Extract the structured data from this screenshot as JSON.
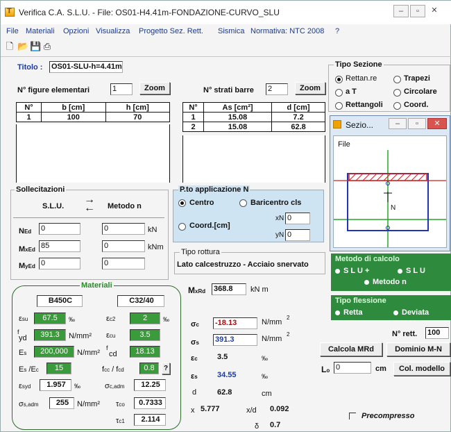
{
  "window": {
    "title": "Verifica C.A. S.L.U. - File: OS01-H4.41m-FONDAZIONE-CURVO_SLU"
  },
  "menu": [
    "File",
    "Materiali",
    "Opzioni",
    "Visualizza",
    "Progetto Sez. Rett.",
    "Sismica",
    "Normativa: NTC 2008",
    "?"
  ],
  "toolbar_icons": [
    "new-icon",
    "open-icon",
    "save-icon",
    "print-icon"
  ],
  "titolo": {
    "label": "Titolo :",
    "value": "OS01-SLU-h=4.41m"
  },
  "figure": {
    "label": "N° figure elementari",
    "value": "1",
    "zoom": "Zoom",
    "headers": [
      "N°",
      "b [cm]",
      "h [cm]"
    ],
    "rows": [
      [
        "1",
        "100",
        "70"
      ]
    ]
  },
  "strati": {
    "label": "N° strati barre",
    "value": "2",
    "zoom": "Zoom",
    "headers": [
      "N°",
      "As [cm²]",
      "d [cm]"
    ],
    "rows": [
      [
        "1",
        "15.08",
        "7.2"
      ],
      [
        "2",
        "15.08",
        "62.8"
      ]
    ]
  },
  "tipo_sezione": {
    "title": "Tipo Sezione",
    "options": [
      "Rettan.re",
      "Trapezi",
      "a T",
      "Circolare",
      "Rettangoli",
      "Coord."
    ],
    "selected": "Rettan.re"
  },
  "sezio_window": {
    "title": "Sezio...",
    "menu": "File",
    "n_label": "N"
  },
  "sollecitazioni": {
    "title": "Sollecitazioni",
    "slu": "S.L.U.",
    "metodo": "Metodo n",
    "NEd": "0",
    "MxEd": "85",
    "MyEd": "0",
    "col2": [
      "0",
      "0",
      "0"
    ],
    "unit_n": "kN",
    "unit_m": "kNm"
  },
  "pto_applicazione": {
    "title": "P.to applicazione N",
    "centro": "Centro",
    "baricentro": "Baricentro cls",
    "coord": "Coord.[cm]",
    "xN": "0",
    "yN": "0",
    "xN_label": "xN",
    "yN_label": "yN"
  },
  "tipo_rottura": {
    "title": "Tipo rottura",
    "value": "Lato calcestruzzo - Acciaio snervato"
  },
  "metodo_calcolo": {
    "title": "Metodo di calcolo",
    "opt1": "S L U +",
    "opt2": "S L U",
    "opt3": "Metodo n"
  },
  "tipo_flessione": {
    "title": "Tipo flessione",
    "opt1": "Retta",
    "opt2": "Deviata"
  },
  "materiali": {
    "title": "Materiali",
    "steel": "B450C",
    "concrete": "C32/40",
    "esu": "67.5",
    "ec2": "2",
    "ecu": "3.5",
    "fyd": "391.3",
    "Es": "200,000",
    "fcd": "18.13",
    "EsEc": "15",
    "fccfcd": "0.8",
    "esyd": "1.957",
    "sc_adm": "12.25",
    "ss_adm": "255",
    "tco": "0.7333",
    "tc1": "2.114",
    "unit_permil": "‰",
    "unit_nmm2": "N/mm²",
    "q": "?"
  },
  "results": {
    "MxRd_label": "M",
    "MxRd": "368.8",
    "MxRd_unit": "kN m",
    "sc": "-18.13",
    "ss": "391.3",
    "ec": "3.5",
    "es": "34.55",
    "d": "62.8",
    "x": "5.777",
    "xd": "0.092",
    "delta": "0.7",
    "unit_nmm2": "N/mm",
    "unit_permil": "‰",
    "unit_cm": "cm",
    "x_label": "x",
    "xd_label": "x/d",
    "d_label": "d",
    "delta_label": "δ"
  },
  "n_rett": {
    "label": "N° rett.",
    "value": "100"
  },
  "buttons": {
    "calcola": "Calcola MRd",
    "dominio": "Dominio M-N",
    "col_modello": "Col. modello"
  },
  "L0": {
    "label": "L",
    "value": "0",
    "unit": "cm"
  },
  "precompresso": "Precompresso",
  "colors": {
    "green": "#3a9b3a",
    "panel_green": "#2e8b3e",
    "panel_blue": "#cfe4f2",
    "red_value": "#c00000",
    "blue_value": "#1a3aa8"
  }
}
